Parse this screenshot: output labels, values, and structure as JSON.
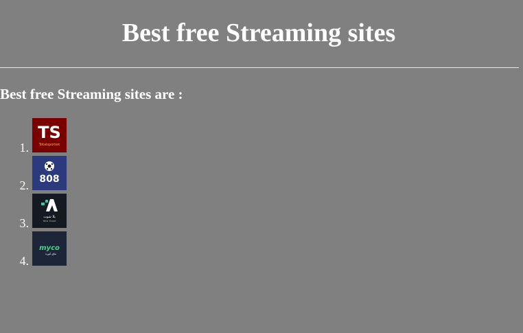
{
  "header": {
    "title": "Best free Streaming sites"
  },
  "content": {
    "subtitle": "Best free Streaming sites are :",
    "items": [
      {
        "number": "1.",
        "logo": "totalsportek-logo",
        "logo_text": "TS",
        "logo_subtext": "Totalsportek",
        "bg": "#7a0000"
      },
      {
        "number": "2.",
        "logo": "808-logo",
        "logo_text": "808",
        "bg": "#2a3a7c"
      },
      {
        "number": "3.",
        "logo": "yalla-shoot-logo",
        "logo_subtext": "يلا شوت",
        "logo_subtext2": "Yalla Shoot",
        "bg": "#141a22"
      },
      {
        "number": "4.",
        "logo": "myco-logo",
        "logo_text": "myco",
        "logo_subtext": "ماي كورة",
        "bg": "#1c2638"
      }
    ]
  }
}
